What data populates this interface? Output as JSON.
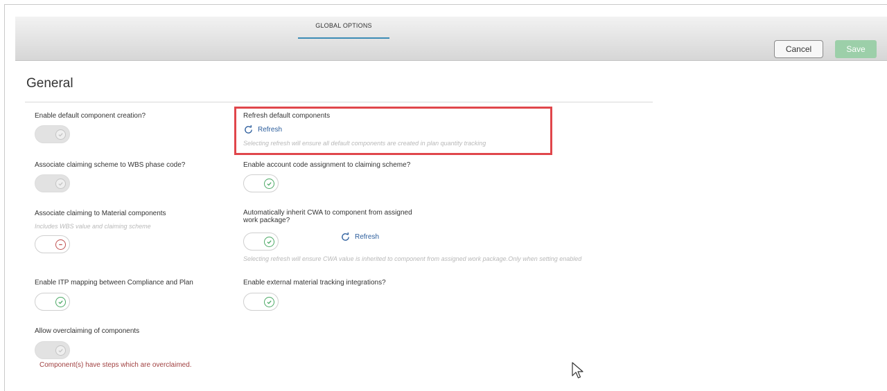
{
  "tabs": {
    "global_options": "GLOBAL OPTIONS"
  },
  "actions": {
    "cancel": "Cancel",
    "save": "Save"
  },
  "section": {
    "title": "General"
  },
  "settings": {
    "enable_default_component": {
      "label": "Enable default component creation?",
      "state": "disabled"
    },
    "refresh_default_components": {
      "label": "Refresh default components",
      "link": "Refresh",
      "hint": "Selecting refresh will ensure all default components are created in plan quantity tracking"
    },
    "associate_claiming_wbs": {
      "label": "Associate claiming scheme to WBS phase code?",
      "state": "disabled"
    },
    "enable_account_code": {
      "label": "Enable account code assignment to claiming scheme?",
      "state": "on"
    },
    "associate_claiming_material": {
      "label": "Associate claiming to Material components",
      "hint": "Includes WBS value and claiming scheme",
      "state": "off"
    },
    "inherit_cwa": {
      "label_line1": "Automatically inherit CWA to component from assigned",
      "label_line2": "work package?",
      "link": "Refresh",
      "hint": "Selecting refresh will ensure CWA value is inherited to component from assigned work package.Only when setting enabled",
      "state": "on"
    },
    "enable_itp_mapping": {
      "label": "Enable ITP mapping between Compliance and Plan",
      "state": "on"
    },
    "enable_external_material": {
      "label": "Enable external material tracking integrations?",
      "state": "on"
    },
    "allow_overclaiming": {
      "label": "Allow overclaiming of components",
      "error": "Component(s) have steps which are overclaimed.",
      "state": "disabled"
    }
  },
  "colors": {
    "accent": "#3b8bb5",
    "save": "#9ccfa9",
    "link": "#2b5d9c",
    "highlight": "#e0464b",
    "toggle_on": "#4aa864",
    "error": "#a04040"
  },
  "icons": {
    "refresh": "refresh-icon",
    "check": "check-icon",
    "minus": "minus-icon",
    "cursor": "mouse-cursor-icon"
  }
}
